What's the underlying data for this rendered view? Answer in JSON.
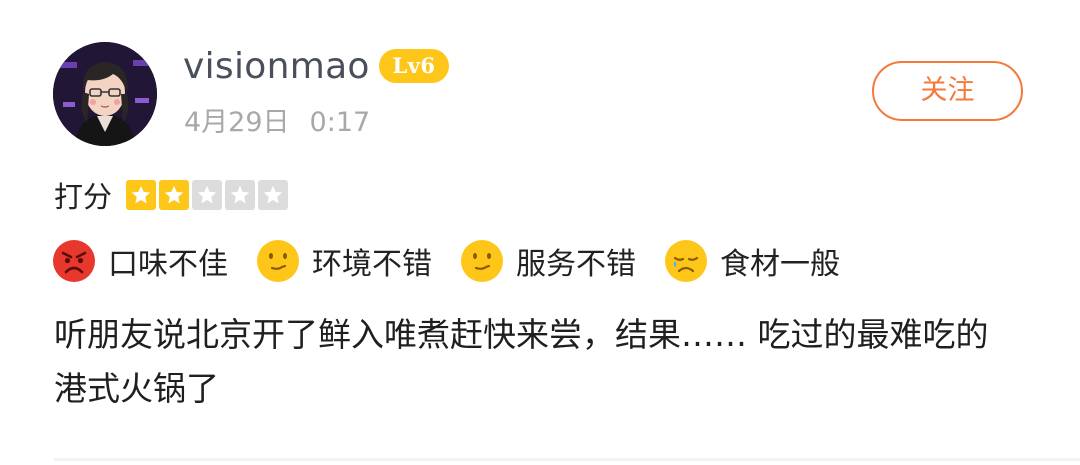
{
  "user": {
    "name": "visionmao",
    "level": "Lv6",
    "date": "4月29日",
    "time": "0:17"
  },
  "follow_label": "关注",
  "rating": {
    "label": "打分",
    "stars": 2,
    "max_stars": 5
  },
  "tags": [
    {
      "icon": "angry-face-icon",
      "label": "口味不佳"
    },
    {
      "icon": "neutral-face-icon",
      "label": "环境不错"
    },
    {
      "icon": "neutral-face-icon",
      "label": "服务不错"
    },
    {
      "icon": "sad-face-icon",
      "label": "食材一般"
    }
  ],
  "review_text": "听朋友说北京开了鲜入唯煮赶快来尝，结果…… 吃过的最难吃的港式火锅了",
  "colors": {
    "accent": "#f47a3a",
    "badge": "#ffc61a",
    "angry": "#e8372c",
    "face": "#ffc61a"
  }
}
